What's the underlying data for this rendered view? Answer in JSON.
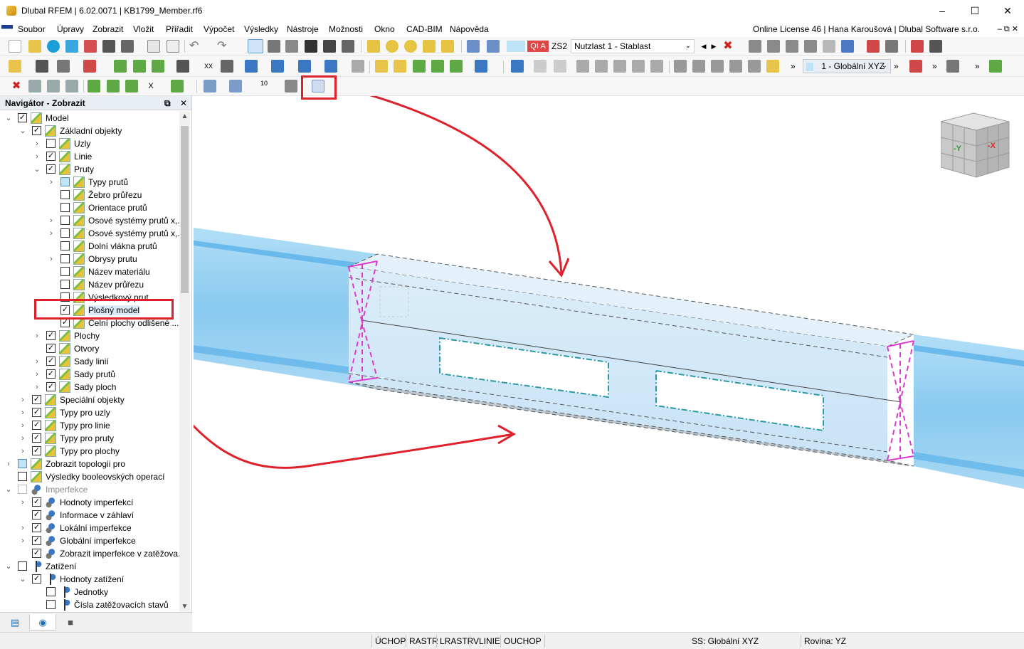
{
  "window": {
    "title": "Dlubal RFEM | 6.02.0071 | KB1799_Member.rf6",
    "minimize": "–",
    "maximize": "☐",
    "close": "✕"
  },
  "menu": {
    "items": [
      "Soubor",
      "Úpravy",
      "Zobrazit",
      "Vložit",
      "Přiřadit",
      "Výpočet",
      "Výsledky",
      "Nástroje",
      "Možnosti",
      "Okno",
      "CAD-BIM",
      "Nápověda"
    ],
    "license": "Online License 46 | Hana Karoušová | Dlubal Software s.r.o.",
    "license_icons": "– ⧉ ✕"
  },
  "toolbar": {
    "load_case_badge": "QI A",
    "load_case_code": "ZS2",
    "load_case_name": "Nutzlast 1 - Stablast",
    "view_combo": "1 - Globální XYZ",
    "x_label": "X",
    "xx_label": "XX",
    "ten_label": "10"
  },
  "navigator": {
    "title": "Navigátor - Zobrazit",
    "pin_icon": "⧉",
    "close_icon": "✕",
    "rows": [
      {
        "label": "Model",
        "level": 0,
        "exp": "v",
        "check": "checked",
        "icon": "model"
      },
      {
        "label": "Základní objekty",
        "level": 1,
        "exp": "v",
        "check": "checked",
        "icon": "model"
      },
      {
        "label": "Uzly",
        "level": 2,
        "exp": ">",
        "check": "none",
        "icon": "model"
      },
      {
        "label": "Linie",
        "level": 2,
        "exp": ">",
        "check": "checked",
        "icon": "model"
      },
      {
        "label": "Pruty",
        "level": 2,
        "exp": "v",
        "check": "checked",
        "icon": "model"
      },
      {
        "label": "Typy prutů",
        "level": 3,
        "exp": ">",
        "check": "partial",
        "icon": "model"
      },
      {
        "label": "Žebro průřezu",
        "level": 3,
        "exp": "",
        "check": "none",
        "icon": "model"
      },
      {
        "label": "Orientace prutů",
        "level": 3,
        "exp": "",
        "check": "none",
        "icon": "model"
      },
      {
        "label": "Osové systémy prutů x,...",
        "level": 3,
        "exp": ">",
        "check": "none",
        "icon": "model"
      },
      {
        "label": "Osové systémy prutů x,...",
        "level": 3,
        "exp": ">",
        "check": "none",
        "icon": "model"
      },
      {
        "label": "Dolní vlákna prutů",
        "level": 3,
        "exp": "",
        "check": "none",
        "icon": "model"
      },
      {
        "label": "Obrysy prutu",
        "level": 3,
        "exp": ">",
        "check": "none",
        "icon": "model"
      },
      {
        "label": "Název materiálu",
        "level": 3,
        "exp": "",
        "check": "none",
        "icon": "model"
      },
      {
        "label": "Název průřezu",
        "level": 3,
        "exp": "",
        "check": "none",
        "icon": "model"
      },
      {
        "label": "Výsledkový prut",
        "level": 3,
        "exp": "",
        "check": "none",
        "icon": "model"
      },
      {
        "label": "Plošný model",
        "level": 3,
        "exp": "",
        "check": "checked",
        "icon": "model",
        "selected": true
      },
      {
        "label": "Čelní plochy odlišené ...",
        "level": 3,
        "exp": "",
        "check": "checked",
        "icon": "model"
      },
      {
        "label": "Plochy",
        "level": 2,
        "exp": ">",
        "check": "checked",
        "icon": "model"
      },
      {
        "label": "Otvory",
        "level": 2,
        "exp": "",
        "check": "checked",
        "icon": "model"
      },
      {
        "label": "Sady linií",
        "level": 2,
        "exp": ">",
        "check": "checked",
        "icon": "model"
      },
      {
        "label": "Sady prutů",
        "level": 2,
        "exp": ">",
        "check": "checked",
        "icon": "model"
      },
      {
        "label": "Sady ploch",
        "level": 2,
        "exp": ">",
        "check": "checked",
        "icon": "model"
      },
      {
        "label": "Speciální objekty",
        "level": 1,
        "exp": ">",
        "check": "checked",
        "icon": "model"
      },
      {
        "label": "Typy pro uzly",
        "level": 1,
        "exp": ">",
        "check": "checked",
        "icon": "model"
      },
      {
        "label": "Typy pro linie",
        "level": 1,
        "exp": ">",
        "check": "checked",
        "icon": "model"
      },
      {
        "label": "Typy pro pruty",
        "level": 1,
        "exp": ">",
        "check": "checked",
        "icon": "model"
      },
      {
        "label": "Typy pro plochy",
        "level": 1,
        "exp": ">",
        "check": "checked",
        "icon": "model"
      },
      {
        "label": "Zobrazit topologii pro",
        "level": 0,
        "exp": ">",
        "check": "partial",
        "icon": "model"
      },
      {
        "label": "Výsledky booleovských operací",
        "level": 0,
        "exp": "",
        "check": "none",
        "icon": "model"
      },
      {
        "label": "Imperfekce",
        "level": 0,
        "exp": "v",
        "check": "disabled",
        "icon": "imp",
        "disabled": true
      },
      {
        "label": "Hodnoty imperfekcí",
        "level": 1,
        "exp": ">",
        "check": "checked",
        "icon": "imp"
      },
      {
        "label": "Informace v záhlaví",
        "level": 1,
        "exp": "",
        "check": "checked",
        "icon": "imp"
      },
      {
        "label": "Lokální imperfekce",
        "level": 1,
        "exp": ">",
        "check": "checked",
        "icon": "imp"
      },
      {
        "label": "Globální imperfekce",
        "level": 1,
        "exp": ">",
        "check": "checked",
        "icon": "imp"
      },
      {
        "label": "Zobrazit imperfekce v zatěžova...",
        "level": 1,
        "exp": "",
        "check": "checked",
        "icon": "imp"
      },
      {
        "label": "Zatížení",
        "level": 0,
        "exp": "v",
        "check": "none",
        "icon": "load"
      },
      {
        "label": "Hodnoty zatížení",
        "level": 1,
        "exp": "v",
        "check": "checked",
        "icon": "load"
      },
      {
        "label": "Jednotky",
        "level": 2,
        "exp": "",
        "check": "none",
        "icon": "load"
      },
      {
        "label": "Čísla zatěžovacích stavů",
        "level": 2,
        "exp": "",
        "check": "none",
        "icon": "load"
      }
    ],
    "tab_icons": [
      "data-icon",
      "eye-icon",
      "camera-icon"
    ]
  },
  "viewcube": {
    "minus_y": "-Y",
    "minus_x": "-X"
  },
  "status": {
    "items": [
      "ÚCHOP",
      "RASTR",
      "LRASTR",
      "VLINIE",
      "OUCHOP"
    ],
    "coord_system": "SS: Globální XYZ",
    "plane": "Rovina: YZ"
  },
  "colors": {
    "beam_fill": "#7cc3ee",
    "highlight_red": "#e0202a",
    "end_plate_magenta": "#dd3bd0",
    "opening_teal": "#2a9aa0"
  }
}
